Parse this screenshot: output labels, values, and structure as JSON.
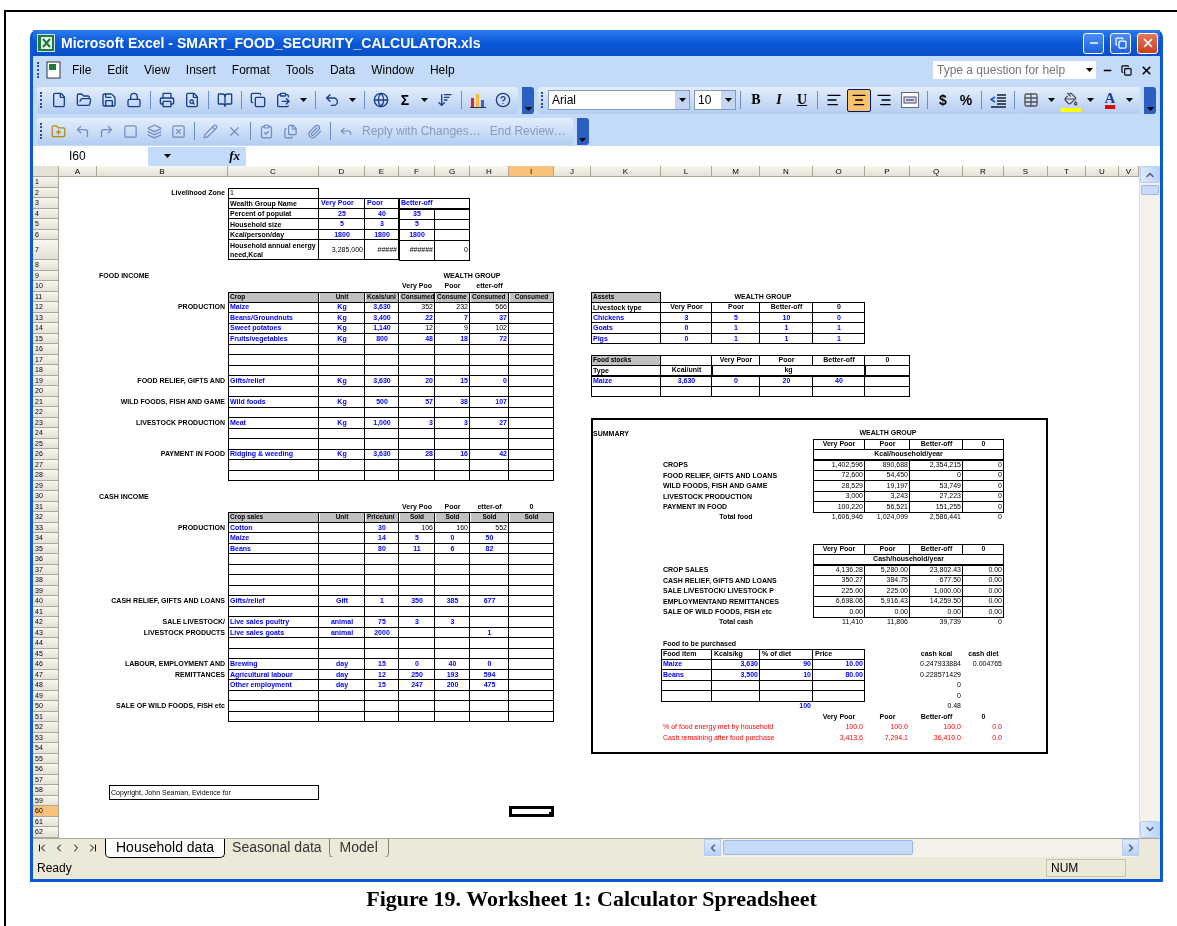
{
  "window": {
    "title": "Microsoft Excel - SMART_FOOD_SECURITY_CALCULATOR.xls"
  },
  "menu": [
    "File",
    "Edit",
    "View",
    "Insert",
    "Format",
    "Tools",
    "Data",
    "Window",
    "Help"
  ],
  "help_box": {
    "placeholder": "Type a question for help"
  },
  "standard_toolbar": {
    "sum": "Σ"
  },
  "format_toolbar": {
    "font": "Arial",
    "size": "10",
    "text_styles": [
      "B",
      "I",
      "U"
    ],
    "alignments": [
      {
        "kind": "left",
        "selected": false
      },
      {
        "kind": "center",
        "selected": true
      },
      {
        "kind": "right",
        "selected": false
      },
      {
        "kind": "merge",
        "selected": false
      }
    ],
    "number_formats": [
      "$",
      "%"
    ],
    "font_color": "A"
  },
  "review_toolbar": {
    "reply": "Reply with Changes…",
    "end_review": "End Review…"
  },
  "formula_bar": {
    "name_box": "I60",
    "function_label": "fx"
  },
  "columns": [
    {
      "label": "A",
      "selected": false
    },
    {
      "label": "B",
      "selected": false
    },
    {
      "label": "C",
      "selected": false
    },
    {
      "label": "D",
      "selected": false
    },
    {
      "label": "E",
      "selected": false
    },
    {
      "label": "F",
      "selected": false
    },
    {
      "label": "G",
      "selected": false
    },
    {
      "label": "H",
      "selected": false
    },
    {
      "label": "I",
      "selected": true
    },
    {
      "label": "J",
      "selected": false
    },
    {
      "label": "K",
      "selected": false
    },
    {
      "label": "L",
      "selected": false
    },
    {
      "label": "M",
      "selected": false
    },
    {
      "label": "N",
      "selected": false
    },
    {
      "label": "O",
      "selected": false
    },
    {
      "label": "P",
      "selected": false
    },
    {
      "label": "Q",
      "selected": false
    },
    {
      "label": "R",
      "selected": false
    },
    {
      "label": "S",
      "selected": false
    },
    {
      "label": "T",
      "selected": false
    },
    {
      "label": "U",
      "selected": false
    },
    {
      "label": "V",
      "selected": false
    }
  ],
  "rows": [
    {
      "number": "1",
      "selected": false
    },
    {
      "number": "2",
      "selected": false,
      "cells": {
        "B": {
          "kind": "label",
          "text": "Livelihood Zone"
        },
        "C": {
          "kind": "text",
          "text": "1"
        }
      }
    },
    {
      "number": "3",
      "selected": false,
      "cells": {
        "C": {
          "kind": "heading",
          "text": "Wealth Group Name"
        },
        "D": {
          "kind": "in",
          "text": "Very Poor"
        },
        "E": {
          "kind": "in",
          "text": "Poor"
        },
        "F:G": {
          "kind": "in",
          "text": "Better-off"
        }
      }
    },
    {
      "number": "4",
      "selected": false,
      "cells": {
        "C": {
          "kind": "heading",
          "text": "Percent of populat"
        },
        "D": {
          "kind": "in-c",
          "text": "25"
        },
        "E": {
          "kind": "in-c",
          "text": "40"
        },
        "F": {
          "kind": "in-c",
          "text": "35"
        }
      }
    },
    {
      "number": "5",
      "selected": false,
      "cells": {
        "C": {
          "kind": "heading",
          "text": "Household size"
        },
        "D": {
          "kind": "in-c",
          "text": "5"
        },
        "E": {
          "kind": "in-c",
          "text": "3"
        },
        "F": {
          "kind": "in-c",
          "text": "5"
        }
      }
    },
    {
      "number": "6",
      "selected": false,
      "cells": {
        "C": {
          "kind": "heading",
          "text": "Kcal/person/day"
        },
        "D": {
          "kind": "in-c",
          "text": "1800"
        },
        "E": {
          "kind": "in-c",
          "text": "1800"
        },
        "F": {
          "kind": "in-c",
          "text": "1800"
        }
      }
    },
    {
      "number": "7",
      "selected": false,
      "cells": {
        "C": {
          "kind": "heading",
          "text": "Household annual energy need,Kcal"
        },
        "D": {
          "kind": "num",
          "text": "3,285,000"
        },
        "E": {
          "kind": "num",
          "text": "#####"
        },
        "F": {
          "kind": "num",
          "text": "######"
        },
        "G": {
          "kind": "num",
          "text": "0"
        }
      }
    },
    {
      "number": "8",
      "selected": false
    },
    {
      "number": "9",
      "selected": false,
      "cells": {
        "B": {
          "kind": "heading",
          "text": "FOOD INCOME"
        },
        "G:H": {
          "kind": "caption",
          "text": "WEALTH GROUP"
        }
      }
    },
    {
      "number": "10",
      "selected": false,
      "cells": {
        "F": {
          "kind": "caption",
          "text": "Very Poo"
        },
        "G": {
          "kind": "caption",
          "text": "Poor"
        },
        "H": {
          "kind": "caption",
          "text": "etter-off"
        }
      }
    },
    {
      "number": "11",
      "selected": false,
      "cells": {
        "C": {
          "kind": "header",
          "text": "Crop"
        },
        "D": {
          "kind": "header-c",
          "text": "Unit"
        },
        "E": {
          "kind": "header",
          "text": "Kcals/uni"
        },
        "F": {
          "kind": "header",
          "text": "Consumed"
        },
        "G": {
          "kind": "header",
          "text": "Consume"
        },
        "H": {
          "kind": "header",
          "text": "Consumed"
        },
        "I": {
          "kind": "header-c",
          "text": "Consumed"
        },
        "K": {
          "kind": "header",
          "text": "Assets"
        },
        "L:O": {
          "kind": "caption",
          "text": "WEALTH GROUP"
        }
      }
    },
    {
      "number": "12",
      "selected": false,
      "cells": {
        "B": {
          "kind": "label",
          "text": "PRODUCTION"
        },
        "C": {
          "kind": "in",
          "text": "Maize"
        },
        "D": {
          "kind": "in-c",
          "text": "Kg"
        },
        "E": {
          "kind": "in-c",
          "text": "3,630"
        },
        "F": {
          "kind": "num",
          "text": "352"
        },
        "G": {
          "kind": "num",
          "text": "232"
        },
        "H": {
          "kind": "num",
          "text": "566"
        },
        "K": {
          "kind": "heading",
          "text": "Livestock type"
        },
        "L": {
          "kind": "caption",
          "text": "Very Poor"
        },
        "M": {
          "kind": "caption",
          "text": "Poor"
        },
        "N": {
          "kind": "caption",
          "text": "Better-off"
        },
        "O": {
          "kind": "caption",
          "text": "0"
        }
      }
    },
    {
      "number": "13",
      "selected": false,
      "cells": {
        "C": {
          "kind": "in",
          "text": "Beans/Groundnuts"
        },
        "D": {
          "kind": "in-c",
          "text": "Kg"
        },
        "E": {
          "kind": "in-c",
          "text": "3,400"
        },
        "F": {
          "kind": "in-r",
          "text": "22"
        },
        "G": {
          "kind": "in-r",
          "text": "7"
        },
        "H": {
          "kind": "in-r",
          "text": "37"
        },
        "K": {
          "kind": "in",
          "text": "Chickens"
        },
        "L": {
          "kind": "in-c",
          "text": "3"
        },
        "M": {
          "kind": "in-c",
          "text": "5"
        },
        "N": {
          "kind": "in-c",
          "text": "10"
        },
        "O": {
          "kind": "in-c",
          "text": "0"
        }
      }
    },
    {
      "number": "14",
      "selected": false,
      "cells": {
        "C": {
          "kind": "in",
          "text": "Sweet potatoes"
        },
        "D": {
          "kind": "in-c",
          "text": "Kg"
        },
        "E": {
          "kind": "in-c",
          "text": "1,140"
        },
        "F": {
          "kind": "num",
          "text": "12"
        },
        "G": {
          "kind": "num",
          "text": "9"
        },
        "H": {
          "kind": "num",
          "text": "102"
        },
        "K": {
          "kind": "in",
          "text": "Goats"
        },
        "L": {
          "kind": "in-c",
          "text": "0"
        },
        "M": {
          "kind": "in-c",
          "text": "1"
        },
        "N": {
          "kind": "in-c",
          "text": "1"
        },
        "O": {
          "kind": "in-c",
          "text": "1"
        }
      }
    },
    {
      "number": "15",
      "selected": false,
      "cells": {
        "C": {
          "kind": "in",
          "text": "Fruits/vegetables"
        },
        "D": {
          "kind": "in-c",
          "text": "Kg"
        },
        "E": {
          "kind": "in-c",
          "text": "800"
        },
        "F": {
          "kind": "in-r",
          "text": "48"
        },
        "G": {
          "kind": "in-r",
          "text": "18"
        },
        "H": {
          "kind": "in-r",
          "text": "72"
        },
        "K": {
          "kind": "in",
          "text": "Pigs"
        },
        "L": {
          "kind": "in-c",
          "text": "0"
        },
        "M": {
          "kind": "in-c",
          "text": "1"
        },
        "N": {
          "kind": "in-c",
          "text": "1"
        },
        "O": {
          "kind": "in-c",
          "text": "1"
        }
      }
    },
    {
      "number": "16",
      "selected": false
    },
    {
      "number": "17",
      "selected": false,
      "cells": {
        "K": {
          "kind": "header",
          "text": "Food stocks"
        },
        "M": {
          "kind": "caption",
          "text": "Very Poor"
        },
        "N": {
          "kind": "caption",
          "text": "Poor"
        },
        "O": {
          "kind": "caption",
          "text": "Better-off"
        },
        "P": {
          "kind": "caption",
          "text": "0"
        }
      }
    },
    {
      "number": "18",
      "selected": false,
      "cells": {
        "K": {
          "kind": "heading",
          "text": "Type"
        },
        "L": {
          "kind": "caption",
          "text": "Kcal/unit"
        },
        "M:O": {
          "kind": "caption",
          "text": "kg"
        }
      }
    },
    {
      "number": "19",
      "selected": false,
      "cells": {
        "B": {
          "kind": "label",
          "text": "FOOD RELIEF, GIFTS AND"
        },
        "C": {
          "kind": "in",
          "text": "Gifts/relief"
        },
        "D": {
          "kind": "in-c",
          "text": "Kg"
        },
        "E": {
          "kind": "in-c",
          "text": "3,630"
        },
        "F": {
          "kind": "in-r",
          "text": "20"
        },
        "G": {
          "kind": "in-r",
          "text": "15"
        },
        "H": {
          "kind": "in-r",
          "text": "0"
        },
        "K": {
          "kind": "in",
          "text": "Maize"
        },
        "L": {
          "kind": "in-c",
          "text": "3,630"
        },
        "M": {
          "kind": "in-c",
          "text": "0"
        },
        "N": {
          "kind": "in-c",
          "text": "20"
        },
        "O": {
          "kind": "in-c",
          "text": "40"
        }
      }
    },
    {
      "number": "20",
      "selected": false
    },
    {
      "number": "21",
      "selected": false,
      "cells": {
        "B": {
          "kind": "label",
          "text": "WILD FOODS, FISH AND GAME"
        },
        "C": {
          "kind": "in",
          "text": "Wild foods"
        },
        "D": {
          "kind": "in-c",
          "text": "Kg"
        },
        "E": {
          "kind": "in-c",
          "text": "500"
        },
        "F": {
          "kind": "in-r",
          "text": "57"
        },
        "G": {
          "kind": "in-r",
          "text": "38"
        },
        "H": {
          "kind": "in-r",
          "text": "107"
        }
      }
    },
    {
      "number": "22",
      "selected": false
    },
    {
      "number": "23",
      "selected": false,
      "cells": {
        "B": {
          "kind": "label",
          "text": "LIVESTOCK PRODUCTION"
        },
        "C": {
          "kind": "in",
          "text": "Meat"
        },
        "D": {
          "kind": "in-c",
          "text": "Kg"
        },
        "E": {
          "kind": "in-c",
          "text": "1,000"
        },
        "F": {
          "kind": "in-r",
          "text": "3"
        },
        "G": {
          "kind": "in-r",
          "text": "3"
        },
        "H": {
          "kind": "in-r",
          "text": "27"
        }
      }
    },
    {
      "number": "24",
      "selected": false,
      "cells": {
        "K": {
          "kind": "heading",
          "text": "SUMMARY"
        },
        "O:Q": {
          "kind": "caption",
          "text": "WEALTH GROUP"
        }
      }
    },
    {
      "number": "25",
      "selected": false,
      "cells": {
        "O": {
          "kind": "caption",
          "text": "Very Poor"
        },
        "P": {
          "kind": "caption",
          "text": "Poor"
        },
        "Q": {
          "kind": "caption",
          "text": "Better-off"
        },
        "R": {
          "kind": "caption",
          "text": "0"
        }
      }
    },
    {
      "number": "26",
      "selected": false,
      "cells": {
        "B": {
          "kind": "label",
          "text": "PAYMENT IN FOOD"
        },
        "C": {
          "kind": "in",
          "text": "Ridging & weeding"
        },
        "D": {
          "kind": "in-c",
          "text": "Kg"
        },
        "E": {
          "kind": "in-c",
          "text": "3,630"
        },
        "F": {
          "kind": "in-r",
          "text": "28"
        },
        "G": {
          "kind": "in-r",
          "text": "16"
        },
        "H": {
          "kind": "in-r",
          "text": "42"
        },
        "O:R": {
          "kind": "caption",
          "text": "Kcal/household/year"
        }
      }
    },
    {
      "number": "27",
      "selected": false,
      "cells": {
        "L:N": {
          "kind": "heading",
          "text": "CROPS"
        },
        "O": {
          "kind": "num",
          "text": "1,402,596"
        },
        "P": {
          "kind": "num",
          "text": "890,688"
        },
        "Q": {
          "kind": "num",
          "text": "2,354,215"
        },
        "R": {
          "kind": "num",
          "text": "0"
        }
      }
    },
    {
      "number": "28",
      "selected": false,
      "cells": {
        "L:N": {
          "kind": "heading",
          "text": "FOOD RELIEF, GIFTS AND LOANS"
        },
        "O": {
          "kind": "num",
          "text": "72,600"
        },
        "P": {
          "kind": "num",
          "text": "54,450"
        },
        "Q": {
          "kind": "num",
          "text": "0"
        },
        "R": {
          "kind": "num",
          "text": "0"
        }
      }
    },
    {
      "number": "29",
      "selected": false,
      "cells": {
        "L:N": {
          "kind": "heading",
          "text": "WILD FOODS, FISH AND GAME"
        },
        "O": {
          "kind": "num",
          "text": "28,529"
        },
        "P": {
          "kind": "num",
          "text": "19,197"
        },
        "Q": {
          "kind": "num",
          "text": "53,749"
        },
        "R": {
          "kind": "num",
          "text": "0"
        }
      }
    },
    {
      "number": "30",
      "selected": false,
      "cells": {
        "B": {
          "kind": "heading",
          "text": "CASH INCOME"
        },
        "L:N": {
          "kind": "heading",
          "text": "LIVESTOCK PRODUCTION"
        },
        "O": {
          "kind": "num",
          "text": "3,000"
        },
        "P": {
          "kind": "num",
          "text": "3,243"
        },
        "Q": {
          "kind": "num",
          "text": "27,223"
        },
        "R": {
          "kind": "num",
          "text": "0"
        }
      }
    },
    {
      "number": "31",
      "selected": false,
      "cells": {
        "F": {
          "kind": "caption",
          "text": "Very Poo"
        },
        "G": {
          "kind": "caption",
          "text": "Poor"
        },
        "H": {
          "kind": "caption",
          "text": "etter-of"
        },
        "I": {
          "kind": "caption",
          "text": "0"
        },
        "L:N": {
          "kind": "heading",
          "text": "PAYMENT IN FOOD"
        },
        "O": {
          "kind": "num",
          "text": "100,220"
        },
        "P": {
          "kind": "num",
          "text": "56,521"
        },
        "Q": {
          "kind": "num",
          "text": "151,255"
        },
        "R": {
          "kind": "num",
          "text": "0"
        }
      }
    },
    {
      "number": "32",
      "selected": false,
      "cells": {
        "C": {
          "kind": "header",
          "text": "Crop sales"
        },
        "D": {
          "kind": "header-c",
          "text": "Unit"
        },
        "E": {
          "kind": "header",
          "text": "Price/uni"
        },
        "F": {
          "kind": "header-c",
          "text": "Sold"
        },
        "G": {
          "kind": "header-c",
          "text": "Sold"
        },
        "H": {
          "kind": "header-c",
          "text": "Sold"
        },
        "I": {
          "kind": "header-c",
          "text": "Sold"
        },
        "M": {
          "kind": "caption",
          "text": "Total food"
        },
        "O": {
          "kind": "num",
          "text": "1,606,946"
        },
        "P": {
          "kind": "num",
          "text": "1,024,099"
        },
        "Q": {
          "kind": "num",
          "text": "2,586,441"
        },
        "R": {
          "kind": "num",
          "text": "0"
        }
      }
    },
    {
      "number": "33",
      "selected": false,
      "cells": {
        "B": {
          "kind": "label",
          "text": "PRODUCTION"
        },
        "C": {
          "kind": "in",
          "text": "Cotton"
        },
        "E": {
          "kind": "in-c",
          "text": "30"
        },
        "F": {
          "kind": "num",
          "text": "106"
        },
        "G": {
          "kind": "num",
          "text": "160"
        },
        "H": {
          "kind": "num",
          "text": "552"
        }
      }
    },
    {
      "number": "34",
      "selected": false,
      "cells": {
        "C": {
          "kind": "in",
          "text": "Maize"
        },
        "E": {
          "kind": "in-c",
          "text": "14"
        },
        "F": {
          "kind": "in-c",
          "text": "5"
        },
        "G": {
          "kind": "in-c",
          "text": "0"
        },
        "H": {
          "kind": "in-c",
          "text": "50"
        }
      }
    },
    {
      "number": "35",
      "selected": false,
      "cells": {
        "C": {
          "kind": "in",
          "text": "Beans"
        },
        "E": {
          "kind": "in-c",
          "text": "80"
        },
        "F": {
          "kind": "in-c",
          "text": "11"
        },
        "G": {
          "kind": "in-c",
          "text": "6"
        },
        "H": {
          "kind": "in-c",
          "text": "82"
        },
        "O": {
          "kind": "caption",
          "text": "Very Poor"
        },
        "P": {
          "kind": "caption",
          "text": "Poor"
        },
        "Q": {
          "kind": "caption",
          "text": "Better-off"
        },
        "R": {
          "kind": "caption",
          "text": "0"
        }
      }
    },
    {
      "number": "36",
      "selected": false,
      "cells": {
        "O:R": {
          "kind": "caption",
          "text": "Cash/household/year"
        }
      }
    },
    {
      "number": "37",
      "selected": false,
      "cells": {
        "L:N": {
          "kind": "heading",
          "text": "CROP SALES"
        },
        "O": {
          "kind": "num",
          "text": "4,136.28"
        },
        "P": {
          "kind": "num",
          "text": "5,280.00"
        },
        "Q": {
          "kind": "num",
          "text": "23,802.43"
        },
        "R": {
          "kind": "num",
          "text": "0.00"
        }
      }
    },
    {
      "number": "38",
      "selected": false,
      "cells": {
        "L:N": {
          "kind": "heading",
          "text": "CASH RELIEF, GIFTS AND LOANS"
        },
        "O": {
          "kind": "num",
          "text": "350.27"
        },
        "P": {
          "kind": "num",
          "text": "384.75"
        },
        "Q": {
          "kind": "num",
          "text": "677.50"
        },
        "R": {
          "kind": "num",
          "text": "0.00"
        }
      }
    },
    {
      "number": "39",
      "selected": false,
      "cells": {
        "L:N": {
          "kind": "heading",
          "text": "SALE LIVESTOCK/ LIVESTOCK P"
        },
        "O": {
          "kind": "num",
          "text": "225.00"
        },
        "P": {
          "kind": "num",
          "text": "225.00"
        },
        "Q": {
          "kind": "num",
          "text": "1,000.00"
        },
        "R": {
          "kind": "num",
          "text": "0.00"
        }
      }
    },
    {
      "number": "40",
      "selected": false,
      "cells": {
        "B": {
          "kind": "label",
          "text": "CASH RELIEF, GIFTS AND LOANS"
        },
        "C": {
          "kind": "in",
          "text": "Gifts/relief"
        },
        "D": {
          "kind": "in-c",
          "text": "Gift"
        },
        "E": {
          "kind": "in-c",
          "text": "1"
        },
        "F": {
          "kind": "in-c",
          "text": "350"
        },
        "G": {
          "kind": "in-c",
          "text": "385"
        },
        "H": {
          "kind": "in-c",
          "text": "677"
        },
        "L:N": {
          "kind": "heading",
          "text": "EMPLOYMENTAND REMITTANCES"
        },
        "O": {
          "kind": "num",
          "text": "6,698.06"
        },
        "P": {
          "kind": "num",
          "text": "5,916.43"
        },
        "Q": {
          "kind": "num",
          "text": "14,259.50"
        },
        "R": {
          "kind": "num",
          "text": "0.00"
        }
      }
    },
    {
      "number": "41",
      "selected": false,
      "cells": {
        "L:N": {
          "kind": "heading",
          "text": "SALE OF WILD FOODS, FISH etc"
        },
        "O": {
          "kind": "num",
          "text": "0.00"
        },
        "P": {
          "kind": "num",
          "text": "0.00"
        },
        "Q": {
          "kind": "num",
          "text": "0.00"
        },
        "R": {
          "kind": "num",
          "text": "0.00"
        }
      }
    },
    {
      "number": "42",
      "selected": false,
      "cells": {
        "B": {
          "kind": "label",
          "text": "SALE LIVESTOCK/"
        },
        "C": {
          "kind": "in",
          "text": "Live sales poultry"
        },
        "D": {
          "kind": "in-c",
          "text": "animal"
        },
        "E": {
          "kind": "in-c",
          "text": "75"
        },
        "F": {
          "kind": "in-c",
          "text": "3"
        },
        "G": {
          "kind": "in-c",
          "text": "3"
        },
        "M": {
          "kind": "caption",
          "text": "Total cash"
        },
        "O": {
          "kind": "num",
          "text": "11,410"
        },
        "P": {
          "kind": "num",
          "text": "11,806"
        },
        "Q": {
          "kind": "num",
          "text": "39,739"
        },
        "R": {
          "kind": "num",
          "text": "0"
        }
      }
    },
    {
      "number": "43",
      "selected": false,
      "cells": {
        "B": {
          "kind": "label",
          "text": "LIVESTOCK PRODUCTS"
        },
        "C": {
          "kind": "in",
          "text": "Live sales goats"
        },
        "D": {
          "kind": "in-c",
          "text": "animal"
        },
        "E": {
          "kind": "in-c",
          "text": "2000"
        },
        "H": {
          "kind": "in-c",
          "text": "1"
        }
      }
    },
    {
      "number": "44",
      "selected": false,
      "cells": {
        "L:N": {
          "kind": "heading",
          "text": "Food  to be purchased"
        }
      }
    },
    {
      "number": "45",
      "selected": false,
      "cells": {
        "L": {
          "kind": "heading",
          "text": "Food item"
        },
        "M": {
          "kind": "heading",
          "text": "Kcals/kg"
        },
        "N": {
          "kind": "heading",
          "text": "% of diet"
        },
        "O": {
          "kind": "heading",
          "text": "Price"
        },
        "Q": {
          "kind": "caption",
          "text": "cash kcal"
        },
        "R": {
          "kind": "caption",
          "text": "cash diet"
        }
      }
    },
    {
      "number": "46",
      "selected": false,
      "cells": {
        "B": {
          "kind": "label",
          "text": "LABOUR, EMPLOYMENT AND"
        },
        "C": {
          "kind": "in",
          "text": "Brewing"
        },
        "D": {
          "kind": "in-c",
          "text": "day"
        },
        "E": {
          "kind": "in-c",
          "text": "15"
        },
        "F": {
          "kind": "in-c",
          "text": "0"
        },
        "G": {
          "kind": "in-c",
          "text": "40"
        },
        "H": {
          "kind": "in-c",
          "text": "0"
        },
        "L": {
          "kind": "in",
          "text": "Maize"
        },
        "M": {
          "kind": "in-r",
          "text": "3,630"
        },
        "N": {
          "kind": "in-r",
          "text": "90"
        },
        "O": {
          "kind": "in-r",
          "text": "10.00"
        },
        "Q": {
          "kind": "num",
          "text": "0.247933884"
        },
        "R": {
          "kind": "num",
          "text": "0.004765"
        }
      }
    },
    {
      "number": "47",
      "selected": false,
      "cells": {
        "B": {
          "kind": "label",
          "text": "REMITTANCES"
        },
        "C": {
          "kind": "in",
          "text": "Agricultural labour"
        },
        "D": {
          "kind": "in-c",
          "text": "day"
        },
        "E": {
          "kind": "in-c",
          "text": "12"
        },
        "F": {
          "kind": "in-c",
          "text": "250"
        },
        "G": {
          "kind": "in-c",
          "text": "193"
        },
        "H": {
          "kind": "in-c",
          "text": "594"
        },
        "L": {
          "kind": "in",
          "text": "Beans"
        },
        "M": {
          "kind": "in-r",
          "text": "3,500"
        },
        "N": {
          "kind": "in-r",
          "text": "10"
        },
        "O": {
          "kind": "in-r",
          "text": "80.00"
        },
        "Q": {
          "kind": "num",
          "text": "0.228571429"
        }
      }
    },
    {
      "number": "48",
      "selected": false,
      "cells": {
        "C": {
          "kind": "in",
          "text": "Other employment"
        },
        "D": {
          "kind": "in-c",
          "text": "day"
        },
        "E": {
          "kind": "in-c",
          "text": "15"
        },
        "F": {
          "kind": "in-c",
          "text": "247"
        },
        "G": {
          "kind": "in-c",
          "text": "200"
        },
        "H": {
          "kind": "in-c",
          "text": "475"
        },
        "Q": {
          "kind": "num",
          "text": "0"
        }
      }
    },
    {
      "number": "49",
      "selected": false,
      "cells": {
        "Q": {
          "kind": "num",
          "text": "0"
        }
      }
    },
    {
      "number": "50",
      "selected": false,
      "cells": {
        "B": {
          "kind": "label",
          "text": "SALE OF WILD FOODS, FISH etc"
        },
        "N": {
          "kind": "in-r",
          "text": "100"
        },
        "Q": {
          "kind": "num",
          "text": "0.48"
        }
      }
    },
    {
      "number": "51",
      "selected": false,
      "cells": {
        "O": {
          "kind": "caption",
          "text": "Very Poor"
        },
        "P": {
          "kind": "caption",
          "text": "Poor"
        },
        "Q": {
          "kind": "caption",
          "text": "Better-off"
        },
        "R": {
          "kind": "caption",
          "text": "0"
        }
      }
    },
    {
      "number": "52",
      "selected": false,
      "cells": {
        "L:N": {
          "kind": "red",
          "text": "% of food energy met by household"
        },
        "O": {
          "kind": "red-num",
          "text": "100.0"
        },
        "P": {
          "kind": "red-num",
          "text": "100.0"
        },
        "Q": {
          "kind": "red-num",
          "text": "100.0"
        },
        "R": {
          "kind": "red-num",
          "text": "0.0"
        }
      }
    },
    {
      "number": "53",
      "selected": false,
      "cells": {
        "L:N": {
          "kind": "red",
          "text": "Cash remaining after food purchase"
        },
        "O": {
          "kind": "red-num",
          "text": "3,413.6"
        },
        "P": {
          "kind": "red-num",
          "text": "7,294.1"
        },
        "Q": {
          "kind": "red-num",
          "text": "36,410.0"
        },
        "R": {
          "kind": "red-num",
          "text": "0.0"
        }
      }
    },
    {
      "number": "54",
      "selected": false
    },
    {
      "number": "55",
      "selected": false
    },
    {
      "number": "56",
      "selected": false
    },
    {
      "number": "57",
      "selected": false
    },
    {
      "number": "58",
      "selected": false,
      "cells": {
        "B:C": {
          "kind": "note",
          "text": "Copyright, John Seaman, Evidence for"
        }
      }
    },
    {
      "number": "59",
      "selected": false
    },
    {
      "number": "60",
      "selected": true
    },
    {
      "number": "61",
      "selected": false
    },
    {
      "number": "62",
      "selected": false
    }
  ],
  "sheet_tabs": [
    {
      "label": "Household data",
      "selected": true
    },
    {
      "label": "Seasonal data",
      "selected": false
    },
    {
      "label": "Model",
      "selected": false
    }
  ],
  "status_bar": {
    "state": "Ready",
    "indicator": "NUM"
  },
  "caption": "Figure 19. Worksheet 1: Calculator Spreadsheet"
}
